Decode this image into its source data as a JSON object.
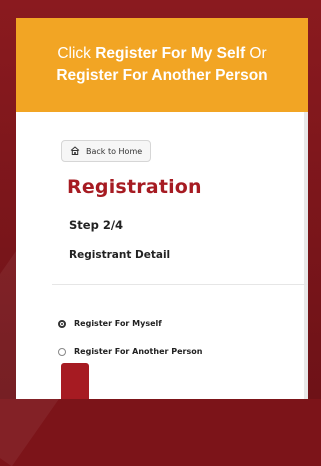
{
  "banner": {
    "prefix": "Click ",
    "option_self": "Register For My Self",
    "connector": " Or",
    "option_other": "Register For Another Person"
  },
  "back_button": {
    "label": "Back to Home",
    "icon": "home-icon"
  },
  "page": {
    "title": "Registration",
    "step": "Step 2/4",
    "section": "Registrant Detail"
  },
  "options": [
    {
      "label": "Register For Myself",
      "checked": true
    },
    {
      "label": "Register For Another Person",
      "checked": false
    }
  ],
  "colors": {
    "accent": "#a61b22",
    "banner": "#f2a524",
    "background": "#7c1419"
  }
}
